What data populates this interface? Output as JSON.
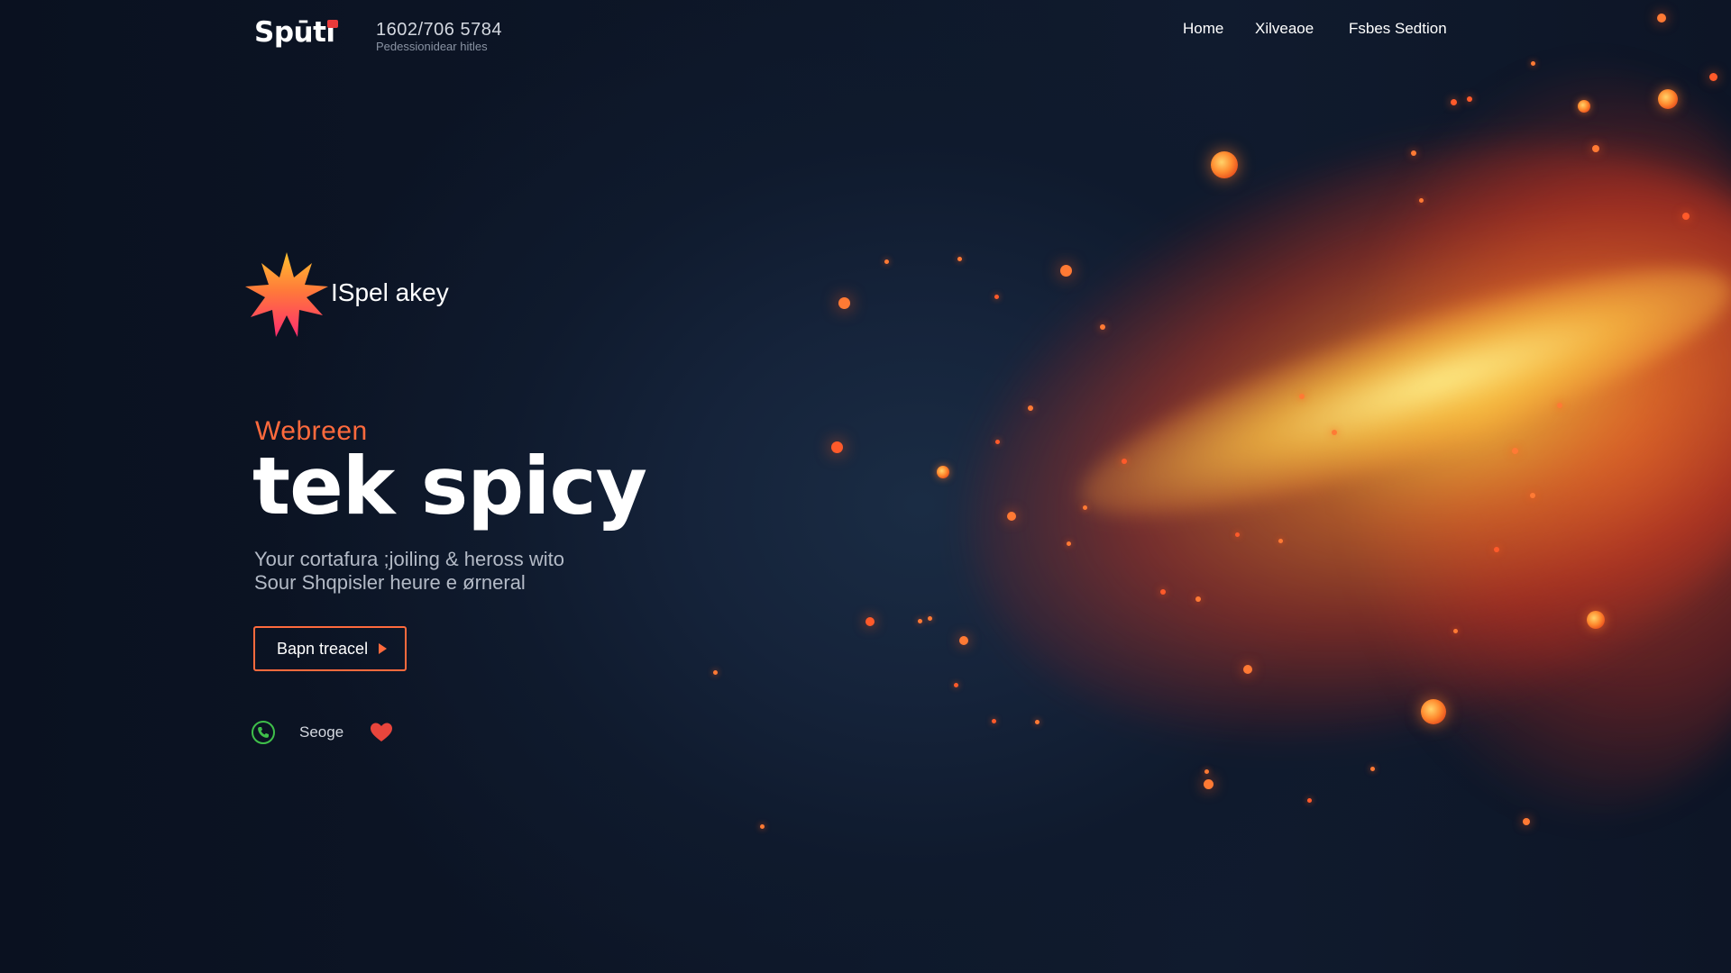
{
  "header": {
    "logo": "Spūti",
    "phone": "1602/706 5784",
    "tagline": "Pedessionidear hitles",
    "nav": [
      {
        "label": "Home"
      },
      {
        "label": "Xilveaoe"
      },
      {
        "label": "Fsbes Sedtion"
      }
    ]
  },
  "badge": {
    "label": "ISpel akey",
    "icon": "starburst-icon"
  },
  "hero": {
    "eyebrow": "Webreen",
    "headline": "tek spicy",
    "subtitle_lines": [
      "Your cortafura ;joiling & heross wito",
      "Sour Shqpisler heure e ørneral"
    ],
    "cta_label": "Bapn treacel"
  },
  "social": {
    "label": "Seoge",
    "icons": [
      "phone-icon",
      "heart-icon"
    ]
  },
  "colors": {
    "accent": "#ff6a3d",
    "background": "#0c1322",
    "phone_icon": "#3fbf4a",
    "heart": "#e8453c"
  }
}
